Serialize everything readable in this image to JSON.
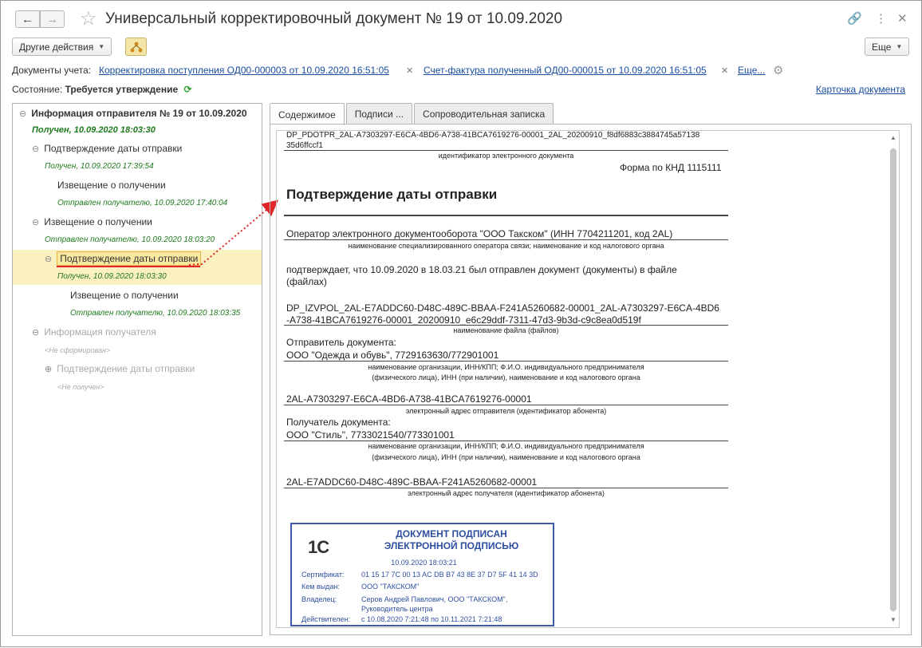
{
  "window": {
    "title": "Универсальный корректировочный документ № 19 от 10.09.2020"
  },
  "toolbar": {
    "other_actions": "Другие действия",
    "more": "Еще"
  },
  "accounting_docs": {
    "label": "Документы учета:",
    "link1": "Корректировка поступления ОД00-000003 от 10.09.2020 16:51:05",
    "link2": "Счет-фактура полученный ОД00-000015 от 10.09.2020 16:51:05",
    "more": "Еще..."
  },
  "state": {
    "label": "Состояние:",
    "value": "Требуется утверждение"
  },
  "card_link": "Карточка документа",
  "tree": {
    "root": "Информация отправителя № 19 от 10.09.2020",
    "root_status": "Получен, 10.09.2020 18:03:30",
    "n1": "Подтверждение даты отправки",
    "n1_status": "Получен, 10.09.2020 17:39:54",
    "n1a": "Извещение о получении",
    "n1a_status": "Отправлен получателю, 10.09.2020 17:40:04",
    "n2": "Извещение о получении",
    "n2_status": "Отправлен получателю, 10.09.2020 18:03:20",
    "n3": "Подтверждение даты отправки",
    "n3_status": "Получен, 10.09.2020 18:03:30",
    "n3a": "Извещение о получении",
    "n3a_status": "Отправлен получателю, 10.09.2020 18:03:35",
    "n4": "Информация получателя",
    "n4_status": "<Не сформирован>",
    "n4a": "Подтверждение даты отправки",
    "n4a_status": "<Не получен>"
  },
  "tabs": [
    "Содержимое",
    "Подписи ...",
    "Сопроводительная записка"
  ],
  "doc": {
    "id_line1": "DP_PDOTPR_2AL-A7303297-E6CA-4BD6-A738-41BCA7619276-00001_2AL_20200910_f8df6883c3884745a57138",
    "id_line2": "35d6ffccf1",
    "id_caption": "идентификатор электронного документа",
    "form": "Форма по КНД 1115111",
    "heading": "Подтверждение даты отправки",
    "operator": "Оператор электронного документооборота \"ООО Такском\" (ИНН 7704211201, код 2AL)",
    "operator_caption": "наименование специализированного оператора связи; наименование и код налогового органа",
    "confirm1": "подтверждает, что 10.09.2020 в 18.03.21 был отправлен документ  (документы) в файле",
    "confirm2": "(файлах)",
    "file1": "DP_IZVPOL_2AL-E7ADDC60-D48C-489C-BBAA-F241A5260682-00001_2AL-A7303297-E6CA-4BD6",
    "file2": "-A738-41BCA7619276-00001_20200910_e6c29ddf-7311-47d3-9b3d-c9c8ea0d519f",
    "file_caption": "наименование файла (файлов)",
    "sender_label": "Отправитель документа:",
    "sender": "ООО \"Одежда и обувь\", 7729163630/772901001",
    "org_caption1": "наименование организации, ИНН/КПП; Ф.И.О. индивидуального предпринимателя",
    "org_caption2": "(физического лица), ИНН (при наличии), наименование и код налогового органа",
    "sender_addr": "2AL-A7303297-E6CA-4BD6-A738-41BCA7619276-00001",
    "sender_addr_caption": "электронный адрес отправителя (идентификатор абонента)",
    "recipient_label": "Получатель документа:",
    "recipient": "ООО \"Стиль\", 7733021540/773301001",
    "recipient_addr": "2AL-E7ADDC60-D48C-489C-BBAA-F241A5260682-00001",
    "recipient_addr_caption": "электронный адрес получателя (идентификатор абонента)"
  },
  "stamp": {
    "logo": "1С",
    "title1": "ДОКУМЕНТ ПОДПИСАН",
    "title2": "ЭЛЕКТРОННОЙ ПОДПИСЬЮ",
    "date": "10.09.2020 18:03:21",
    "cert_label": "Сертификат:",
    "cert": "01 15 17 7C 00 13 AC DB B7 43 8E 37 D7 5F 41 14 3D",
    "issuer_label": "Кем выдан:",
    "issuer": "ООО \"ТАКСКОМ\"",
    "owner_label": "Владелец:",
    "owner1": "Серов Андрей Павлович, ООО \"ТАКСКОМ\",",
    "owner2": "Руководитель центра",
    "valid_label": "Действителен:",
    "valid": "с 10.08.2020 7:21:48 по 10.11.2021 7:21:48"
  }
}
